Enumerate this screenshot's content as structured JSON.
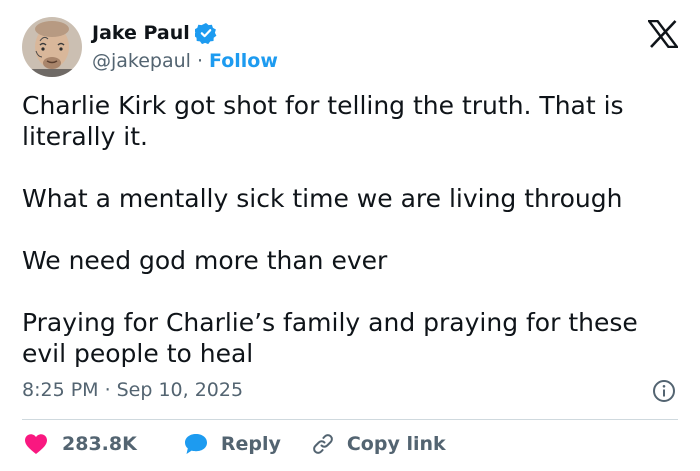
{
  "author": {
    "display_name": "Jake Paul",
    "handle": "@jakepaul",
    "separator": "·",
    "follow_label": "Follow"
  },
  "tweet": {
    "paragraphs": [
      "Charlie Kirk got shot for telling the truth. That is literally it.",
      "What a mentally sick time we are living through",
      "We need god more than ever",
      "Praying for Charlie’s family and praying for these evil people to heal"
    ],
    "time": "8:25 PM",
    "meta_separator": "·",
    "date": "Sep 10, 2025"
  },
  "actions": {
    "like_count": "283.8K",
    "reply_label": "Reply",
    "copy_label": "Copy link"
  },
  "colors": {
    "accent": "#1d9bf0",
    "like": "#f91880",
    "text": "#0f1419",
    "muted": "#536471",
    "divider": "#cfd9de"
  },
  "icons": [
    "verified-badge-icon",
    "x-logo-icon",
    "info-icon",
    "heart-icon",
    "reply-bubble-icon",
    "link-icon"
  ]
}
